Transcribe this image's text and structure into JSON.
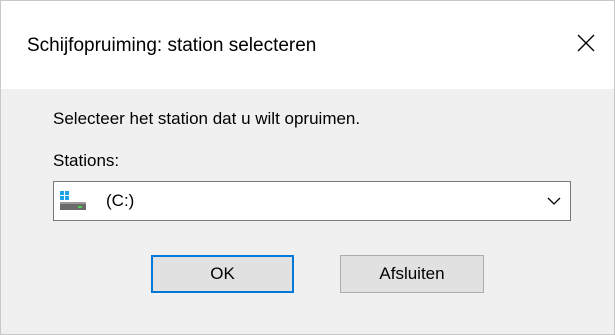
{
  "window": {
    "title": "Schijfopruiming: station selecteren",
    "close_icon": "close-icon"
  },
  "dialog": {
    "instruction": "Selecteer het station dat u wilt opruimen.",
    "drives_label": "Stations:",
    "drive_select": {
      "selected": "(C:)",
      "icon": "drive-windows-icon",
      "dropdown_icon": "chevron-down-icon"
    },
    "buttons": {
      "ok": "OK",
      "exit": "Afsluiten"
    }
  },
  "colors": {
    "accent": "#0078d7",
    "dialog_bg": "#f0f0f0",
    "button_bg": "#e1e1e1"
  }
}
